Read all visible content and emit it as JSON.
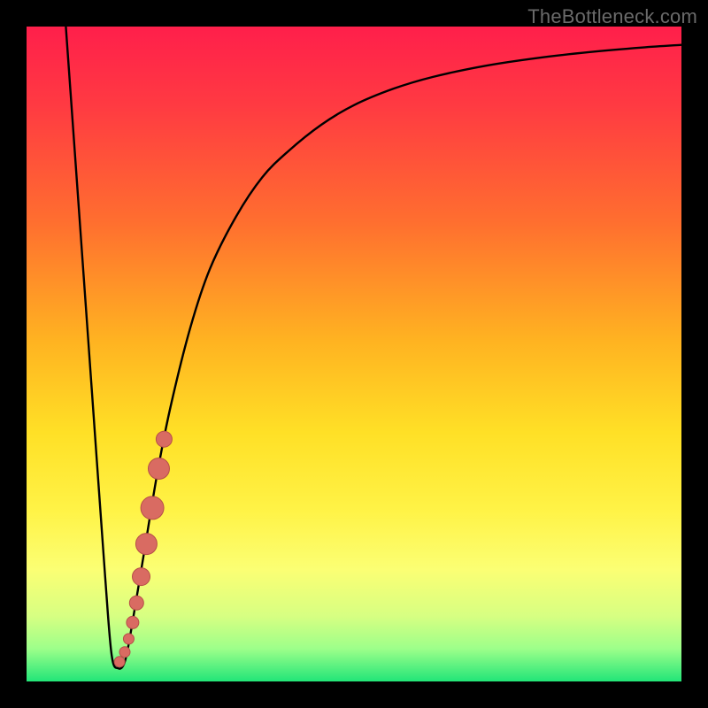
{
  "watermark": "TheBottleneck.com",
  "colors": {
    "frame": "#000000",
    "curve": "#000000",
    "dot_fill": "#d96b62",
    "dot_stroke": "#b64f48",
    "gradient_stops": [
      {
        "offset": 0.0,
        "color": "#ff1f4b"
      },
      {
        "offset": 0.12,
        "color": "#ff3a42"
      },
      {
        "offset": 0.3,
        "color": "#ff6f2f"
      },
      {
        "offset": 0.48,
        "color": "#ffb321"
      },
      {
        "offset": 0.62,
        "color": "#ffe026"
      },
      {
        "offset": 0.74,
        "color": "#fff347"
      },
      {
        "offset": 0.83,
        "color": "#fbff74"
      },
      {
        "offset": 0.9,
        "color": "#d7ff82"
      },
      {
        "offset": 0.95,
        "color": "#9dff8a"
      },
      {
        "offset": 1.0,
        "color": "#22e578"
      }
    ]
  },
  "chart_data": {
    "type": "line",
    "title": "",
    "xlabel": "",
    "ylabel": "",
    "xlim": [
      0,
      100
    ],
    "ylim": [
      0,
      100
    ],
    "series": [
      {
        "name": "bottleneck-curve",
        "x": [
          6,
          8,
          10,
          12,
          13,
          14,
          15,
          16,
          18,
          20,
          22,
          25,
          28,
          32,
          36,
          40,
          45,
          50,
          56,
          62,
          70,
          78,
          86,
          94,
          100
        ],
        "y": [
          100,
          72,
          44,
          16,
          4,
          2,
          3,
          8,
          20,
          32,
          42,
          54,
          63,
          71,
          77,
          81,
          85,
          88,
          90.5,
          92.3,
          94,
          95.2,
          96.1,
          96.8,
          97.2
        ]
      }
    ],
    "scatter": {
      "name": "highlight-dots",
      "points": [
        {
          "x": 14.2,
          "y": 3.0,
          "r": 6
        },
        {
          "x": 15.0,
          "y": 4.5,
          "r": 6
        },
        {
          "x": 15.6,
          "y": 6.5,
          "r": 6
        },
        {
          "x": 16.2,
          "y": 9.0,
          "r": 7
        },
        {
          "x": 16.8,
          "y": 12.0,
          "r": 8
        },
        {
          "x": 17.5,
          "y": 16.0,
          "r": 10
        },
        {
          "x": 18.3,
          "y": 21.0,
          "r": 12
        },
        {
          "x": 19.2,
          "y": 26.5,
          "r": 13
        },
        {
          "x": 20.2,
          "y": 32.5,
          "r": 12
        },
        {
          "x": 21.0,
          "y": 37.0,
          "r": 9
        }
      ]
    }
  }
}
